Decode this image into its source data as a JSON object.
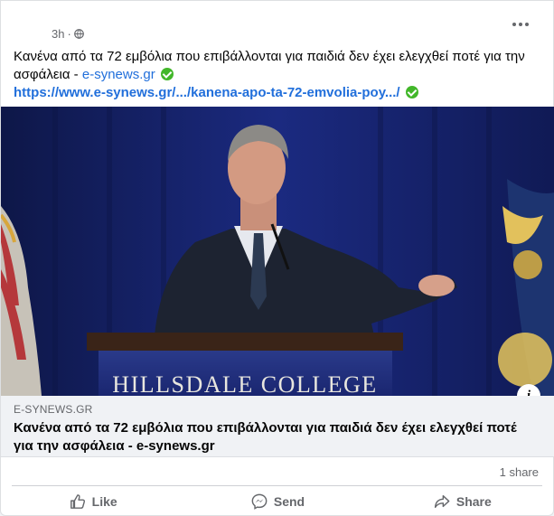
{
  "post": {
    "time": "3h",
    "text": "Κανένα από τα 72 εμβόλια που επιβάλλονται για παιδιά δεν έχει ελεγχθεί ποτέ για την ασφάλεια - ",
    "source_link": "e-synews.gr",
    "url": "https://www.e-synews.gr/.../kanena-apo-ta-72-emvolia-poy.../"
  },
  "media": {
    "podium_text": "HILLSDALE COLLEGE"
  },
  "preview": {
    "domain": "E-SYNEWS.GR",
    "title": "Κανένα από τα 72 εμβόλια που επιβάλλονται για παιδιά δεν έχει ελεγχθεί ποτέ για την ασφάλεια - e-synews.gr"
  },
  "counts": {
    "shares": "1 share"
  },
  "actions": {
    "like": "Like",
    "send": "Send",
    "share": "Share"
  },
  "colors": {
    "link": "#216fdb",
    "verified": "#42b72a",
    "muted": "#65676b"
  }
}
